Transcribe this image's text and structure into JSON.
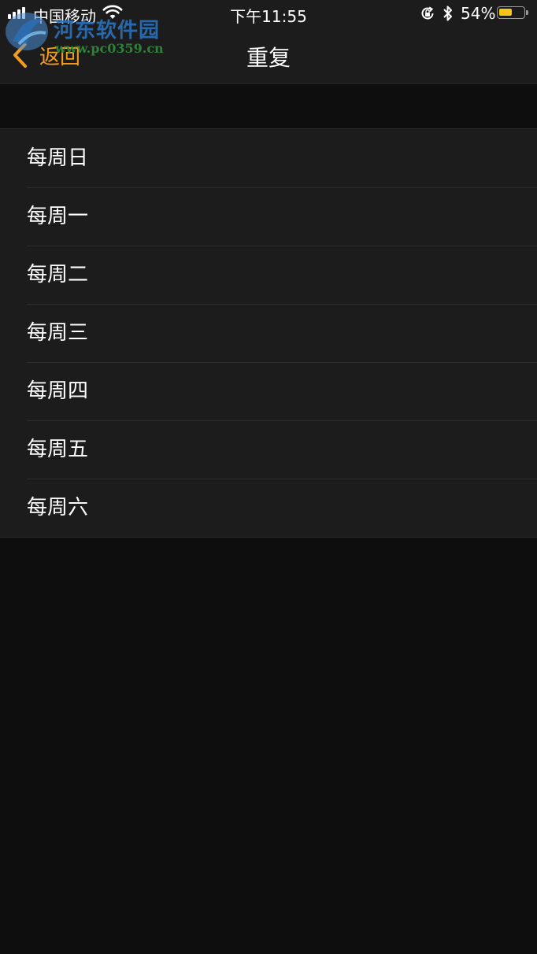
{
  "status_bar": {
    "carrier": "中国移动",
    "time": "下午11:55",
    "battery_percent": "54%",
    "battery_level": 0.54
  },
  "watermark": {
    "name": "河东软件园",
    "url": "www.pc0359.cn"
  },
  "nav": {
    "back_label": "返回",
    "title": "重复"
  },
  "repeat_options": [
    {
      "label": "每周日"
    },
    {
      "label": "每周一"
    },
    {
      "label": "每周二"
    },
    {
      "label": "每周三"
    },
    {
      "label": "每周四"
    },
    {
      "label": "每周五"
    },
    {
      "label": "每周六"
    }
  ],
  "colors": {
    "accent": "#f39c1d",
    "background": "#0e0e0e",
    "cell_background": "#1c1c1c",
    "battery": "#f5c518"
  },
  "icons": [
    "signal-icon",
    "wifi-icon",
    "orientation-lock-icon",
    "bluetooth-icon",
    "battery-icon",
    "chevron-left-icon"
  ]
}
